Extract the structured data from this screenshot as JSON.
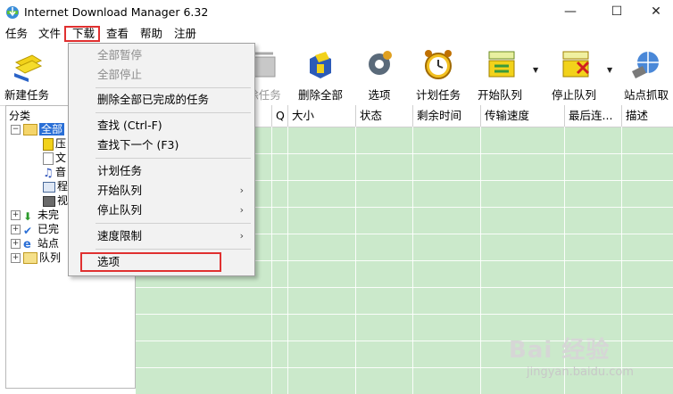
{
  "window": {
    "title": "Internet Download Manager 6.32",
    "minimize": "—",
    "maximize": "☐",
    "close": "✕"
  },
  "menubar": {
    "items": [
      "任务",
      "文件",
      "下载",
      "查看",
      "帮助",
      "注册"
    ]
  },
  "toolbar": {
    "buttons": [
      {
        "label": "新建任务",
        "icon": "new-task-icon"
      },
      {
        "label": "除任务",
        "icon": "delete-task-icon"
      },
      {
        "label": "删除全部",
        "icon": "delete-all-icon"
      },
      {
        "label": "选项",
        "icon": "options-gear-icon"
      },
      {
        "label": "计划任务",
        "icon": "scheduler-clock-icon"
      },
      {
        "label": "开始队列",
        "icon": "start-queue-icon"
      },
      {
        "label": "停止队列",
        "icon": "stop-queue-icon"
      },
      {
        "label": "站点抓取",
        "icon": "site-grabber-icon"
      }
    ]
  },
  "tree": {
    "header": "分类",
    "items": [
      {
        "label": "全部",
        "icon": "folder-open-icon",
        "expander": "−"
      },
      {
        "label": "压",
        "icon": "archive-icon"
      },
      {
        "label": "文",
        "icon": "document-icon"
      },
      {
        "label": "音",
        "icon": "music-icon"
      },
      {
        "label": "程",
        "icon": "program-icon"
      },
      {
        "label": "视",
        "icon": "video-icon"
      },
      {
        "label": "未完",
        "icon": "unfinished-icon",
        "expander": "+"
      },
      {
        "label": "已完",
        "icon": "finished-icon",
        "expander": "+"
      },
      {
        "label": "站点",
        "icon": "site-icon",
        "expander": "+"
      },
      {
        "label": "队列",
        "icon": "queue-folder-icon",
        "expander": "+"
      }
    ]
  },
  "grid": {
    "columns": [
      "Q",
      "大小",
      "状态",
      "剩余时间",
      "传输速度",
      "最后连...",
      "描述"
    ]
  },
  "dropdown": {
    "items": [
      {
        "label": "全部暂停",
        "disabled": true
      },
      {
        "label": "全部停止",
        "disabled": true
      },
      {
        "label": "删除全部已完成的任务",
        "disabled": false
      },
      {
        "label": "查找 (Ctrl-F)",
        "disabled": false
      },
      {
        "label": "查找下一个 (F3)",
        "disabled": false
      },
      {
        "label": "计划任务",
        "disabled": false
      },
      {
        "label": "开始队列",
        "disabled": false,
        "submenu": "›"
      },
      {
        "label": "停止队列",
        "disabled": false,
        "submenu": "›"
      },
      {
        "label": "速度限制",
        "disabled": false,
        "submenu": "›"
      },
      {
        "label": "选项",
        "disabled": false
      }
    ]
  },
  "watermark": {
    "main": "Bai 经验",
    "sub": "jingyan.baidu.com"
  },
  "colors": {
    "highlight": "#e03030",
    "grid_green": "#cbe9cb",
    "menu_bg": "#f2f2f2"
  }
}
